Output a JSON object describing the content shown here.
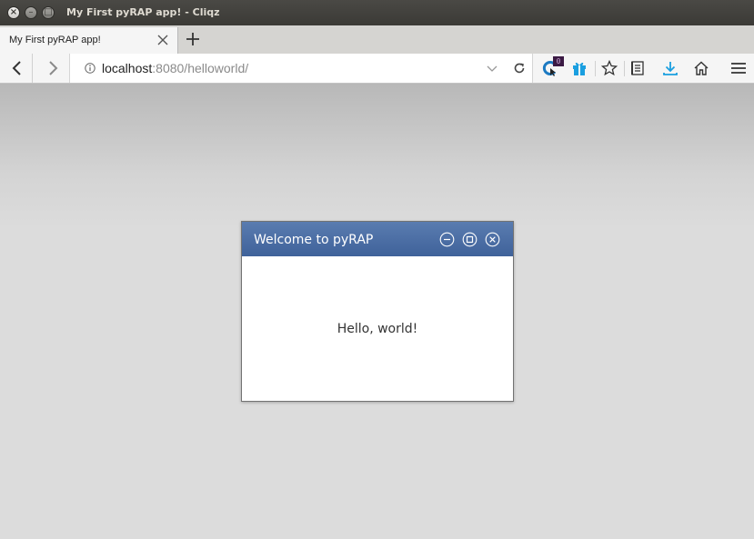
{
  "os_window": {
    "title": "My First pyRAP app! - Cliqz",
    "controls": {
      "close": "×",
      "minimize": "–",
      "maximize": "□"
    }
  },
  "browser": {
    "tab": {
      "title": "My First pyRAP app!"
    },
    "address_bar": {
      "host": "localhost",
      "path": ":8080/helloworld/"
    },
    "extension_badge": "0",
    "accent_colors": {
      "download_blue": "#1a9fe0",
      "cliqz_blue": "#1c7ac2"
    }
  },
  "app": {
    "dialog": {
      "title": "Welcome to pyRAP",
      "body_text": "Hello, world!",
      "header_color": "#4a6ca4"
    }
  }
}
